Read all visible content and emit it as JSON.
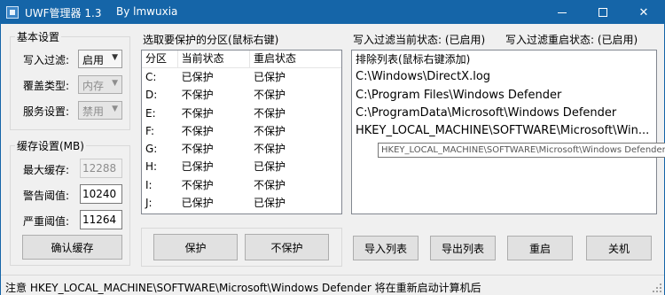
{
  "window": {
    "title": "UWF管理器 1.3",
    "author": "By lmwuxia"
  },
  "basic": {
    "group_title": "基本设置",
    "write_filter_label": "写入过滤:",
    "write_filter_value": "启用",
    "overlay_type_label": "覆盖类型:",
    "overlay_type_value": "内存",
    "service_label": "服务设置:",
    "service_value": "禁用"
  },
  "cache": {
    "group_title": "缓存设置(MB)",
    "max_label": "最大缓存:",
    "max_value": "12288",
    "warn_label": "警告阈值:",
    "warn_value": "10240",
    "critical_label": "严重阈值:",
    "critical_value": "11264",
    "confirm_button": "确认缓存"
  },
  "partitions": {
    "group_title": "选取要保护的分区(鼠标右键)",
    "columns": [
      "分区",
      "当前状态",
      "重启状态"
    ],
    "rows": [
      [
        "C:",
        "已保护",
        "已保护"
      ],
      [
        "D:",
        "不保护",
        "不保护"
      ],
      [
        "E:",
        "不保护",
        "不保护"
      ],
      [
        "F:",
        "不保护",
        "不保护"
      ],
      [
        "G:",
        "不保护",
        "不保护"
      ],
      [
        "H:",
        "已保护",
        "已保护"
      ],
      [
        "I:",
        "不保护",
        "不保护"
      ],
      [
        "J:",
        "已保护",
        "已保护"
      ]
    ],
    "protect_button": "保护",
    "unprotect_button": "不保护"
  },
  "filter": {
    "current_status": "写入过滤当前状态: (已启用)",
    "restart_status": "写入过滤重启状态: (已启用)",
    "list_header": "排除列表(鼠标右键添加)",
    "items": [
      "C:\\Windows\\DirectX.log",
      "C:\\Program Files\\Windows Defender",
      "C:\\ProgramData\\Microsoft\\Windows Defender",
      "HKEY_LOCAL_MACHINE\\SOFTWARE\\Microsoft\\Win..."
    ],
    "tooltip": "HKEY_LOCAL_MACHINE\\SOFTWARE\\Microsoft\\Windows Defender",
    "import_button": "导入列表",
    "export_button": "导出列表",
    "restart_button": "重启",
    "shutdown_button": "关机"
  },
  "status_bar": {
    "text": "注意 HKEY_LOCAL_MACHINE\\SOFTWARE\\Microsoft\\Windows Defender 将在重新启动计算机后"
  },
  "colors": {
    "titlebar": "#1565a8",
    "window_bg": "#f0f0f0"
  }
}
